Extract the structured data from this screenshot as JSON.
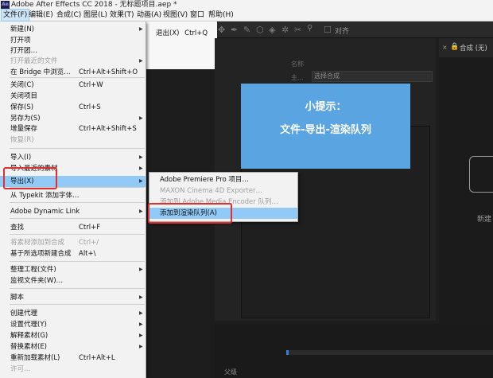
{
  "window": {
    "title": "Adobe After Effects CC 2018 - 无标题项目.aep *",
    "logo": "Ae"
  },
  "menubar": [
    "文件(F)",
    "编辑(E)",
    "合成(C)",
    "图层(L)",
    "效果(T)",
    "动画(A)",
    "视图(V)",
    "窗口",
    "帮助(H)"
  ],
  "file_menu": [
    {
      "label": "新建(N)",
      "shortcut": "",
      "submenu": true,
      "disabled": false
    },
    {
      "label": "打开项",
      "shortcut": "",
      "submenu": false,
      "disabled": false
    },
    {
      "label": "打开团…",
      "shortcut": "",
      "submenu": false,
      "disabled": false
    },
    {
      "label": "打开最近的文件",
      "shortcut": "",
      "submenu": true,
      "disabled": true
    },
    {
      "label": "在 Bridge 中浏览…",
      "shortcut": "Ctrl+Alt+Shift+O",
      "submenu": false,
      "disabled": false
    },
    {
      "label": "关闭(C)",
      "shortcut": "Ctrl+W",
      "submenu": false,
      "disabled": false
    },
    {
      "label": "关闭项目",
      "shortcut": "",
      "submenu": false,
      "disabled": false
    },
    {
      "label": "保存(S)",
      "shortcut": "Ctrl+S",
      "submenu": false,
      "disabled": false
    },
    {
      "label": "另存为(S)",
      "shortcut": "",
      "submenu": true,
      "disabled": false
    },
    {
      "label": "增量保存",
      "shortcut": "Ctrl+Alt+Shift+S",
      "submenu": false,
      "disabled": false
    },
    {
      "label": "恢复(R)",
      "shortcut": "",
      "submenu": false,
      "disabled": true
    },
    {
      "label": "导入(I)",
      "shortcut": "",
      "submenu": true,
      "disabled": false
    },
    {
      "label": "导入最近的素材",
      "shortcut": "",
      "submenu": true,
      "disabled": false
    },
    {
      "label": "导出(X)",
      "shortcut": "",
      "submenu": true,
      "disabled": false,
      "highlighted": true
    },
    {
      "label": "从 Typekit 添加字体…",
      "shortcut": "",
      "submenu": false,
      "disabled": false
    },
    {
      "label": "Adobe Dynamic Link",
      "shortcut": "",
      "submenu": true,
      "disabled": false
    },
    {
      "label": "查找",
      "shortcut": "Ctrl+F",
      "submenu": false,
      "disabled": false
    },
    {
      "label": "将素材添加到合成",
      "shortcut": "Ctrl+/",
      "submenu": false,
      "disabled": true
    },
    {
      "label": "基于所选项新建合成",
      "shortcut": "Alt+\\",
      "submenu": false,
      "disabled": false
    },
    {
      "label": "整理工程(文件)",
      "shortcut": "",
      "submenu": true,
      "disabled": false
    },
    {
      "label": "监视文件夹(W)…",
      "shortcut": "",
      "submenu": false,
      "disabled": false
    },
    {
      "label": "脚本",
      "shortcut": "",
      "submenu": true,
      "disabled": false
    },
    {
      "label": "创建代理",
      "shortcut": "",
      "submenu": true,
      "disabled": false
    },
    {
      "label": "设置代理(Y)",
      "shortcut": "",
      "submenu": true,
      "disabled": false
    },
    {
      "label": "解释素材(G)",
      "shortcut": "",
      "submenu": true,
      "disabled": false
    },
    {
      "label": "替换素材(E)",
      "shortcut": "",
      "submenu": true,
      "disabled": false
    },
    {
      "label": "重新加载素材(L)",
      "shortcut": "Ctrl+Alt+L",
      "submenu": false,
      "disabled": false
    },
    {
      "label": "许可…",
      "shortcut": "",
      "submenu": false,
      "disabled": true
    }
  ],
  "behind_menu": {
    "label": "退出(X)",
    "shortcut": "Ctrl+Q"
  },
  "export_submenu": [
    {
      "label": "Adobe Premiere Pro 项目…",
      "disabled": false
    },
    {
      "label": "MAXON Cinema 4D Exporter…",
      "disabled": true
    },
    {
      "label": "添加到 Adobe Media Encoder 队列…",
      "disabled": true
    },
    {
      "label": "添加到渲染队列(A)",
      "disabled": false,
      "highlighted": true
    }
  ],
  "toolbar": {
    "snap_label": "对齐"
  },
  "project_panel": {
    "name_label": "名称",
    "main_label": "主...",
    "select_label": "选择合成"
  },
  "composition": {
    "tab_label": "合成 (无)",
    "new_label": "新建"
  },
  "tooltip": {
    "title": "小提示：",
    "body": "文件-导出-渲染队列"
  },
  "timeline": {
    "layer_label": "父级"
  },
  "colors": {
    "accent": "#5ba4e2",
    "highlight": "#91c9f7",
    "annotation": "#e0302d"
  }
}
